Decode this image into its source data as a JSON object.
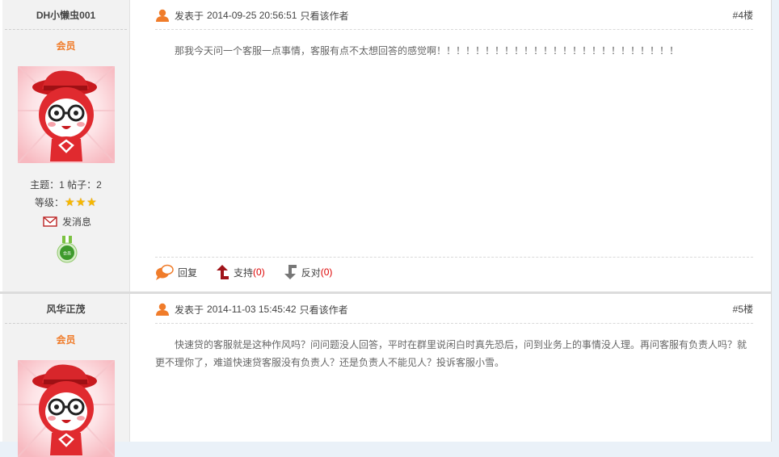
{
  "posts": [
    {
      "author": {
        "name": "DH小懒虫001",
        "role": "会员",
        "stats": "主题：1 帖子：2",
        "level_label": "等级：",
        "stars": 3,
        "message_label": "发消息",
        "medal_text": "会员"
      },
      "posted_prefix": "发表于",
      "datetime": "2014-09-25 20:56:51",
      "author_only": "只看该作者",
      "floor": "#4楼",
      "content": "那我今天问一个客服一点事情，客服有点不太想回答的感觉啊！！！！！！！！！！！！！！！！！！！！！！！！！",
      "actions": {
        "reply": "回复",
        "support": "支持",
        "support_count": "(0)",
        "oppose": "反对",
        "oppose_count": "(0)"
      }
    },
    {
      "author": {
        "name": "风华正茂",
        "role": "会员"
      },
      "posted_prefix": "发表于",
      "datetime": "2014-11-03 15:45:42",
      "author_only": "只看该作者",
      "floor": "#5楼",
      "content": "快速贷的客服就是这种作风吗？问问题没人回答，平时在群里说闲白时真先恐后，问到业务上的事情没人理。再问客服有负责人吗？就更不理你了，难道快速贷客服没有负责人？还是负责人不能见人？投诉客服小雪。"
    }
  ],
  "colors": {
    "accent": "#f07c2a",
    "count": "#dd0000",
    "star": "#f5b800"
  }
}
